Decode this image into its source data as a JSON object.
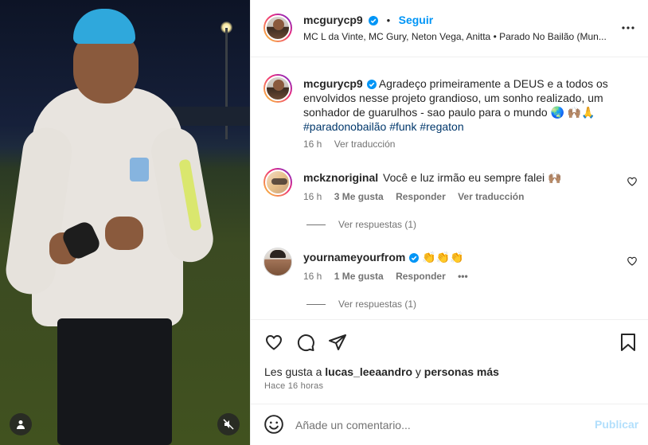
{
  "post": {
    "header": {
      "username": "mcgurycp9",
      "follow_label": "Seguir",
      "separator": "•",
      "subtitle": "MC L da Vinte, MC Gury, Neton Vega, Anitta • Parado No Bailão (Mun..."
    },
    "caption": {
      "username": "mcgurycp9",
      "text": "Agradeço primeiramente a DEUS e a todos os envolvidos nesse projeto grandioso, um sonho realizado, um sonhador de guarulhos - sao paulo para o mundo 🌏 🙌🏽🙏",
      "hashtags": [
        "#paradonobailão",
        "#funk",
        "#regaton"
      ],
      "age": "16 h",
      "translate": "Ver traducción"
    },
    "comments": [
      {
        "username": "mckznoriginal",
        "text": "Você e luz irmão eu sempre falei 🙌🏽",
        "age": "16 h",
        "likes": "3 Me gusta",
        "reply": "Responder",
        "translate": "Ver traducción",
        "replies": "Ver respuestas (1)",
        "verified": false
      },
      {
        "username": "yournameyourfrom",
        "text": "👏👏👏",
        "age": "16 h",
        "likes": "1 Me gusta",
        "reply": "Responder",
        "more": "•••",
        "replies": "Ver respuestas (1)",
        "verified": true
      }
    ],
    "likes_prefix": "Les gusta a",
    "likes_user": "lucas_leeaandro",
    "likes_mid": "y",
    "likes_suffix": "personas más",
    "posted": "Hace 16 horas",
    "composer": {
      "placeholder": "Añade un comentario...",
      "publish": "Publicar"
    }
  },
  "icons": {
    "verified": "verified-badge-icon",
    "more": "more-options-icon",
    "like": "heart-icon",
    "comment": "comment-icon",
    "share": "share-icon",
    "save": "bookmark-icon",
    "emoji": "emoji-icon",
    "user": "user-tag-icon",
    "mute": "muted-audio-icon"
  },
  "colors": {
    "accent": "#0095f6",
    "hashtag": "#00376b",
    "muted_text": "#737373",
    "publish_disabled": "#b2dffc"
  }
}
